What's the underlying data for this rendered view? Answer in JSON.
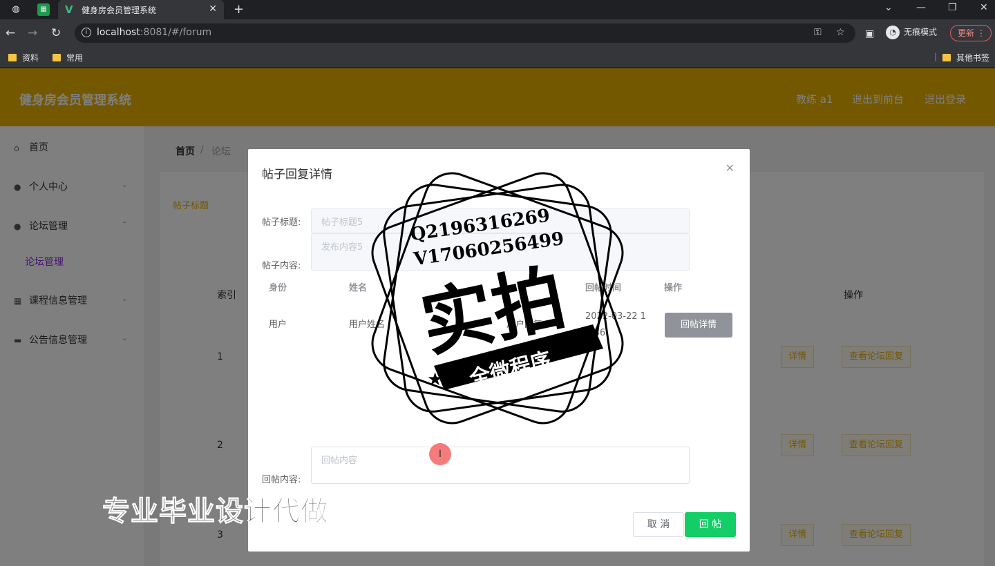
{
  "browser": {
    "tab_title": "健身房会员管理系统",
    "url_host": "localhost",
    "url_rest": ":8081/#/forum",
    "incognito_label": "无痕模式",
    "update_label": "更新",
    "bookmarks": [
      "资料",
      "常用"
    ],
    "other_bookmarks": "其他书签"
  },
  "app": {
    "title": "健身房会员管理系统",
    "nav_links": [
      "教练 a1",
      "退出到前台",
      "退出登录"
    ]
  },
  "sidebar": {
    "items": [
      {
        "label": "首页",
        "icon": "home-icon"
      },
      {
        "label": "个人中心",
        "icon": "user-icon"
      },
      {
        "label": "论坛管理",
        "icon": "user-icon"
      },
      {
        "label": "课程信息管理",
        "icon": "grid-icon"
      },
      {
        "label": "公告信息管理",
        "icon": "monitor-icon"
      }
    ],
    "active_sub": "论坛管理"
  },
  "breadcrumb": {
    "home": "首页",
    "sep": "/",
    "current": "论坛"
  },
  "search": {
    "label": "帖子标题"
  },
  "table": {
    "headers": {
      "index": "索引",
      "action": "操作"
    },
    "rows": [
      {
        "index": "1",
        "detail": "详情",
        "view": "查看论坛回复"
      },
      {
        "index": "2",
        "detail": "详情",
        "view": "查看论坛回复"
      },
      {
        "index": "3",
        "detail": "详情",
        "view": "查看论坛回复"
      }
    ]
  },
  "dialog": {
    "title": "帖子回复详情",
    "post_title_label": "帖子标题:",
    "post_title_value": "帖子标题5",
    "post_content_label": "帖子内容:",
    "post_content_value": "发布内容5",
    "reply_headers": [
      "身份",
      "姓名",
      "回帖时间",
      "操作"
    ],
    "reply_row": {
      "role": "用户",
      "name": "用户姓名",
      "content": "用户回复",
      "time": "2022-03-22 1",
      "time2": "4:36",
      "action": "回帖详情"
    },
    "reply_content_label": "回帖内容:",
    "reply_content_placeholder": "回帖内容",
    "cancel": "取 消",
    "submit": "回 帖"
  },
  "watermark": {
    "line1": "Q2196316269",
    "line2": "V17060256499",
    "big": "实拍",
    "banner": "全微程序",
    "footer": "专业毕业设计代做"
  }
}
